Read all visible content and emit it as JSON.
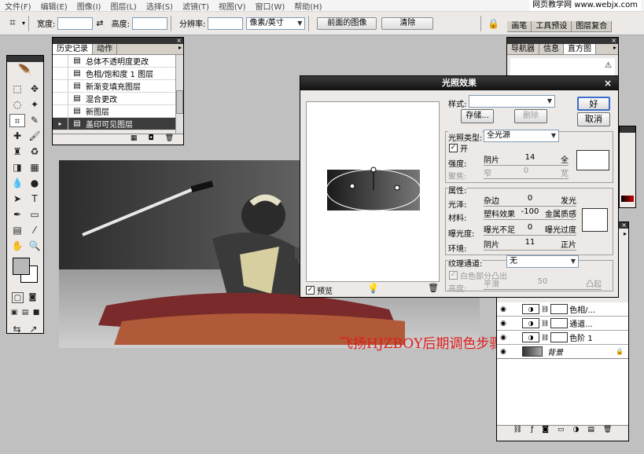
{
  "menu": [
    "文件(F)",
    "编辑(E)",
    "图像(I)",
    "图层(L)",
    "选择(S)",
    "滤镜(T)",
    "视图(V)",
    "窗口(W)",
    "帮助(H)"
  ],
  "watermark": "网页教学网 www.webjx.com",
  "options": {
    "width_label": "宽度:",
    "height_label": "高度:",
    "resolution_label": "分辨率:",
    "unit": "像素/英寸",
    "front_image_btn": "前面的图像",
    "clear_btn": "清除",
    "right_tabs": [
      "画笔",
      "工具预设",
      "图层复合"
    ]
  },
  "history": {
    "tabs": [
      "历史记录",
      "动作"
    ],
    "items": [
      "总体不透明度更改",
      "色相/饱和度 1 图层",
      "新渐变填充图层",
      "混合更改",
      "新图层",
      "盖印可见图层"
    ],
    "selected": 5
  },
  "navigator": {
    "tabs": [
      "导航器",
      "信息",
      "直方图"
    ]
  },
  "layers": {
    "rows": [
      {
        "name": "色相/...",
        "thumb": "adj"
      },
      {
        "name": "通道...",
        "thumb": "adj"
      },
      {
        "name": "色阶 1",
        "thumb": "adj"
      },
      {
        "name": "背景",
        "thumb": "img"
      }
    ]
  },
  "caption": "飞扬HJZBOY后期调色步骤",
  "dialog": {
    "title": "光照效果",
    "ok": "好",
    "cancel": "取消",
    "style_label": "样式:",
    "store_btn": "存储...",
    "delete_btn": "删除",
    "light_type_label": "光照类型:",
    "light_type_value": "全光源",
    "on_label": "开",
    "intensity": {
      "label": "强度:",
      "left": "阴片",
      "value": "14",
      "right": "全"
    },
    "focus": {
      "label": "聚焦:",
      "left": "窄",
      "value": "0",
      "right": "宽"
    },
    "properties_label": "属性:",
    "gloss": {
      "label": "光泽:",
      "left": "杂边",
      "value": "0",
      "right": "发光"
    },
    "material": {
      "label": "材料:",
      "left": "塑料效果",
      "value": "-100",
      "right": "金属质感"
    },
    "exposure": {
      "label": "曝光度:",
      "left": "曝光不足",
      "value": "0",
      "right": "曝光过度"
    },
    "ambience": {
      "label": "环境:",
      "left": "阴片",
      "value": "11",
      "right": "正片"
    },
    "texture_label": "纹理通道:",
    "texture_value": "无",
    "white_high_label": "白色部分凸出",
    "height": {
      "label": "高度:",
      "left": "平滑",
      "value": "50",
      "right": "凸起"
    },
    "preview_label": "预览"
  }
}
